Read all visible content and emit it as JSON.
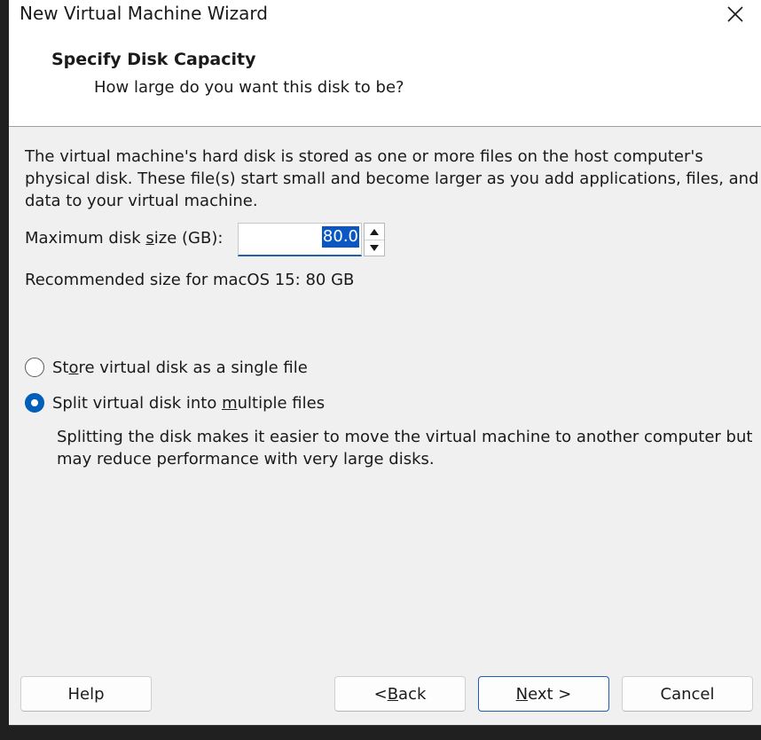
{
  "window": {
    "title": "New Virtual Machine Wizard",
    "close_icon": "close-icon"
  },
  "header": {
    "title": "Specify Disk Capacity",
    "subtitle": "How large do you want this disk to be?"
  },
  "description": "The virtual machine's hard disk is stored as one or more files on the host computer's physical disk. These file(s) start small and become larger as you add applications, files, and data to your virtual machine.",
  "disk_size": {
    "label_pre": "Maximum disk ",
    "label_accel": "s",
    "label_post": "ize (GB):",
    "value": "80.0"
  },
  "recommended": "Recommended size for macOS 15: 80 GB",
  "options": {
    "single": {
      "pre": "St",
      "accel": "o",
      "post": "re virtual disk as a single file",
      "selected": false
    },
    "split": {
      "pre": "Split virtual disk into ",
      "accel": "m",
      "post": "ultiple files",
      "selected": true
    }
  },
  "split_note": "Splitting the disk makes it easier to move the virtual machine to another computer but may reduce performance with very large disks.",
  "buttons": {
    "help": "Help",
    "back_pre": "< ",
    "back_accel": "B",
    "back_post": "ack",
    "next_accel": "N",
    "next_post": "ext >",
    "cancel": "Cancel"
  },
  "colors": {
    "accent": "#005fb8",
    "selection": "#0a56c2",
    "window_bg": "#f0f0f0",
    "header_bg": "#ffffff"
  }
}
